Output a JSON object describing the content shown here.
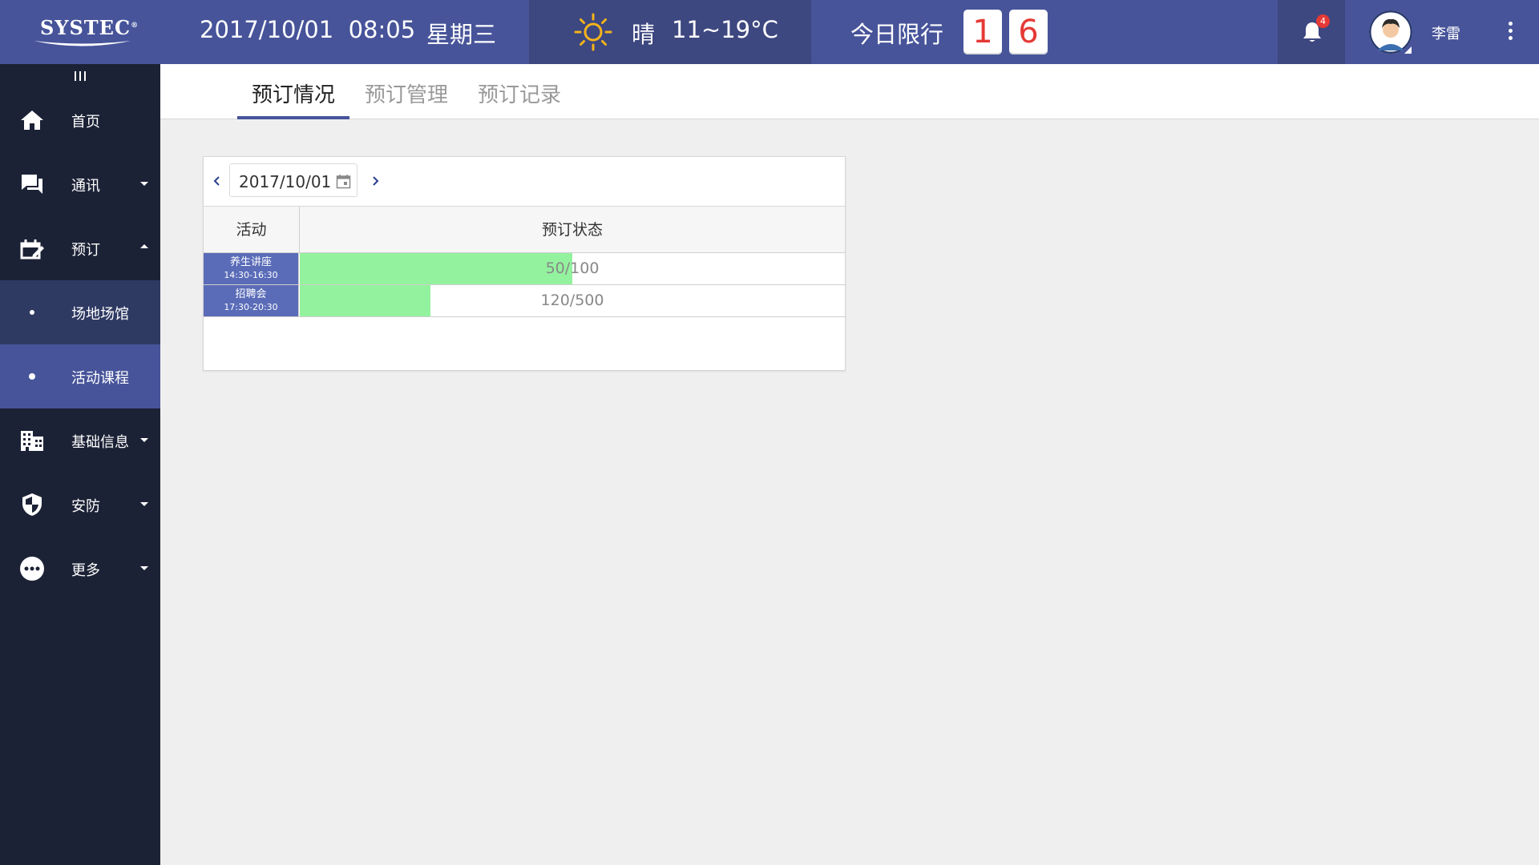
{
  "header": {
    "logo_text": "SYSTEC",
    "logo_mark": "®",
    "date": "2017/10/01",
    "time": "08:05",
    "weekday": "星期三",
    "weather": {
      "icon": "sun-icon",
      "condition": "晴",
      "temperature": "11~19°C"
    },
    "restriction": {
      "label": "今日限行",
      "digits": [
        "1",
        "6"
      ]
    },
    "notifications": {
      "count": "4"
    },
    "user": {
      "name": "李雷"
    }
  },
  "sidebar": {
    "items": [
      {
        "label": "首页",
        "icon": "home-icon"
      },
      {
        "label": "通讯",
        "icon": "chat-icon",
        "expanded": false
      },
      {
        "label": "预订",
        "icon": "booking-icon",
        "expanded": true
      },
      {
        "label": "场地场馆",
        "sub": true,
        "active": false
      },
      {
        "label": "活动课程",
        "sub": true,
        "active": true
      },
      {
        "label": "基础信息",
        "icon": "building-icon",
        "expanded": false
      },
      {
        "label": "安防",
        "icon": "shield-icon",
        "expanded": false
      },
      {
        "label": "更多",
        "icon": "more-icon",
        "expanded": false
      }
    ]
  },
  "tabs": [
    {
      "label": "预订情况",
      "active": true
    },
    {
      "label": "预订管理",
      "active": false
    },
    {
      "label": "预订记录",
      "active": false
    }
  ],
  "booking": {
    "date": "2017/10/01",
    "columns": {
      "activity": "活动",
      "status": "预订状态"
    },
    "rows": [
      {
        "name": "养生讲座",
        "time": "14:30-16:30",
        "booked": 50,
        "capacity": 100,
        "status_text": "50/100"
      },
      {
        "name": "招聘会",
        "time": "17:30-20:30",
        "booked": 120,
        "capacity": 500,
        "status_text": "120/500"
      }
    ]
  },
  "colors": {
    "header_bg": "#47549a",
    "sidebar_bg": "#1c2236",
    "accent": "#47549a",
    "progress_fill": "#93f29e",
    "plate_digit": "#e53935"
  }
}
